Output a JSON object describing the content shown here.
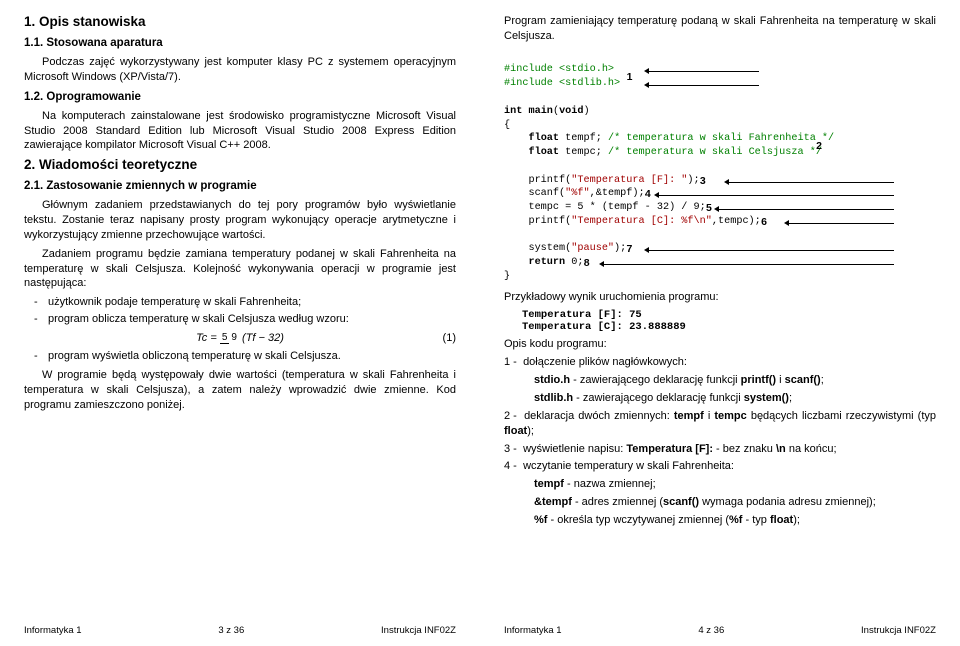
{
  "left": {
    "h1": "1. Opis stanowiska",
    "h11": "1.1. Stosowana aparatura",
    "p11": "Podczas zajęć wykorzystywany jest komputer klasy PC z systemem operacyjnym Microsoft Windows (XP/Vista/7).",
    "h12": "1.2. Oprogramowanie",
    "p12": "Na komputerach zainstalowane jest środowisko programistyczne Microsoft Visual Studio 2008 Standard Edition lub Microsoft Visual Studio 2008 Express Edition zawierające kompilator Microsoft Visual C++ 2008.",
    "h2": "2. Wiadomości teoretyczne",
    "h21": "2.1. Zastosowanie zmiennych w programie",
    "p21a": "Głównym zadaniem przedstawianych do tej pory programów było wyświetlanie tekstu. Zostanie teraz napisany prosty program wykonujący operacje arytmetyczne i wykorzystujący zmienne przechowujące wartości.",
    "p21b": "Zadaniem programu będzie zamiana temperatury podanej w skali Fahrenheita na temperaturę w skali Celsjusza. Kolejność wykonywania operacji w programie jest następująca:",
    "li1": "użytkownik podaje temperaturę w skali Fahrenheita;",
    "li2": "program oblicza temperaturę w skali Celsjusza według wzoru:",
    "eq": "Tc = ",
    "eq_num": "(1)",
    "eq_tail": "(Tf − 32)",
    "li3": "program wyświetla obliczoną temperaturę w skali Celsjusza.",
    "p21c": "W programie będą występowały dwie wartości (temperatura w skali Fahrenheita i temperatura w skali Celsjusza), a zatem należy wprowadzić dwie zmienne. Kod programu zamieszczono poniżej.",
    "foot_l": "Informatyka 1",
    "foot_c": "3 z 36",
    "foot_r": "Instrukcja INF02Z"
  },
  "right": {
    "caption": "Program zamieniający temperaturę podaną w skali Fahrenheita na temperaturę w skali Celsjusza.",
    "code": {
      "l1": "#include <stdio.h>",
      "l2": "#include <stdlib.h>",
      "l3": "int main(void)",
      "l4": "{",
      "l5a": "    float tempf;",
      "l5b": " /* temperatura w skali Fahrenheita */",
      "l6a": "    float tempc;",
      "l6b": " /* temperatura w skali Celsjusza */",
      "l7": "    printf(\"Temperatura [F]: \");",
      "l8": "    scanf(\"%f\",&tempf);",
      "l9": "    tempc = 5 * (tempf - 32) / 9;",
      "l10": "    printf(\"Temperatura [C]: %f\\n\",tempc);",
      "l11": "    system(\"pause\");",
      "l12": "    return 0;",
      "l13": "}"
    },
    "ann": {
      "a1": "1",
      "a2": "2",
      "a3": "3",
      "a4": "4",
      "a5": "5",
      "a6": "6",
      "a7": "7",
      "a8": "8"
    },
    "sample_h": "Przykładowy wynik uruchomienia programu:",
    "sample1": "Temperatura [F]: 75",
    "sample2": "Temperatura [C]: 23.888889",
    "opis_h": "Opis kodu programu:",
    "e1": "dołączenie plików nagłówkowych:",
    "e1a_pre": "stdio.h",
    "e1a": " - zawierającego deklarację funkcji ",
    "e1a_b": "printf()",
    "e1a_mid": " i ",
    "e1a_b2": "scanf()",
    "e1a_end": ";",
    "e1b_pre": "stdlib.h",
    "e1b": " - zawierającego deklarację funkcji ",
    "e1b_b": "system()",
    "e1b_end": ";",
    "e2_pre": "deklaracja dwóch zmiennych: ",
    "e2_b1": "tempf",
    "e2_mid": " i ",
    "e2_b2": "tempc",
    "e2_tail": " będących liczbami rzeczywistymi (typ ",
    "e2_b3": "float",
    "e2_end": ");",
    "e3_pre": "wyświetlenie napisu: ",
    "e3_b": "Temperatura [F]:",
    "e3_tail": " - bez znaku ",
    "e3_b2": "\\n",
    "e3_end": " na końcu;",
    "e4": "wczytanie temperatury w skali Fahrenheita:",
    "e4a_b": "tempf",
    "e4a": " - nazwa zmiennej;",
    "e4b_b": "&tempf",
    "e4b": " - adres zmiennej (",
    "e4b_b2": "scanf()",
    "e4b_end": " wymaga podania adresu zmiennej);",
    "e4c_b": "%f",
    "e4c": " - określa typ wczytywanej zmiennej (",
    "e4c_b2": "%f",
    "e4c_mid": " - typ ",
    "e4c_b3": "float",
    "e4c_end": ");",
    "foot_l": "Informatyka 1",
    "foot_c": "4 z 36",
    "foot_r": "Instrukcja INF02Z"
  }
}
